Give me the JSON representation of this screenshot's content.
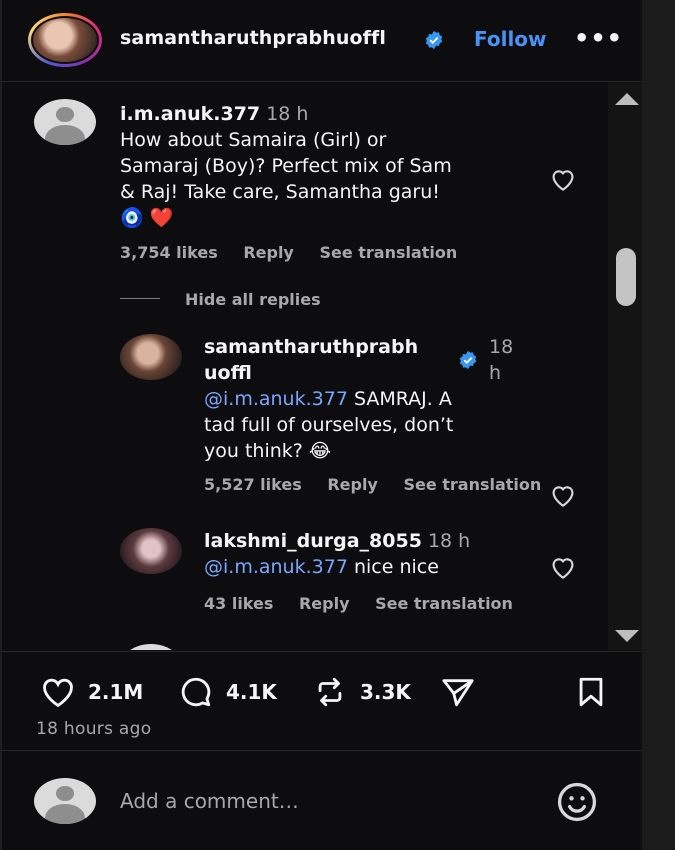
{
  "post": {
    "author": "samantharuthprabhuoffl",
    "follow_label": "Follow",
    "more_label": "•••"
  },
  "comments": [
    {
      "username": "i.m.anuk.377",
      "time": "18 h",
      "text_lines": [
        "How about Samaira (Girl) or",
        "Samaraj (Boy)? Perfect mix of Sam",
        "& Raj! Take care, Samantha garu!"
      ],
      "emoji": "🧿 ❤️",
      "likes": "3,754 likes",
      "reply_label": "Reply",
      "translate_label": "See translation",
      "hide_replies_label": "Hide all replies"
    }
  ],
  "replies": [
    {
      "username_line1": "samantharuthprabh",
      "username_line2": "uoffl",
      "time_line1": "18",
      "time_line2": "h",
      "mention": "@i.m.anuk.377",
      "text_line1": " SAMRAJ. A",
      "text_line2": "tad full of ourselves, don’t",
      "text_line3": "you think? 😂",
      "likes": "5,527 likes",
      "reply_label": "Reply",
      "translate_label": "See translation"
    },
    {
      "username": "lakshmi_durga_8055",
      "time": "18 h",
      "mention": "@i.m.anuk.377",
      "text": " nice nice",
      "likes": "43 likes",
      "reply_label": "Reply",
      "translate_label": "See translation"
    }
  ],
  "actions": {
    "likes": "2.1M",
    "comments": "4.1K",
    "reposts": "3.3K",
    "time_ago": "18 hours ago"
  },
  "add_comment": {
    "placeholder": "Add a comment…"
  },
  "colors": {
    "background": "#0d0d0f",
    "link_blue": "#4a92f5",
    "mention_blue": "#7aa7ff",
    "muted_text": "#a8a8a8"
  }
}
